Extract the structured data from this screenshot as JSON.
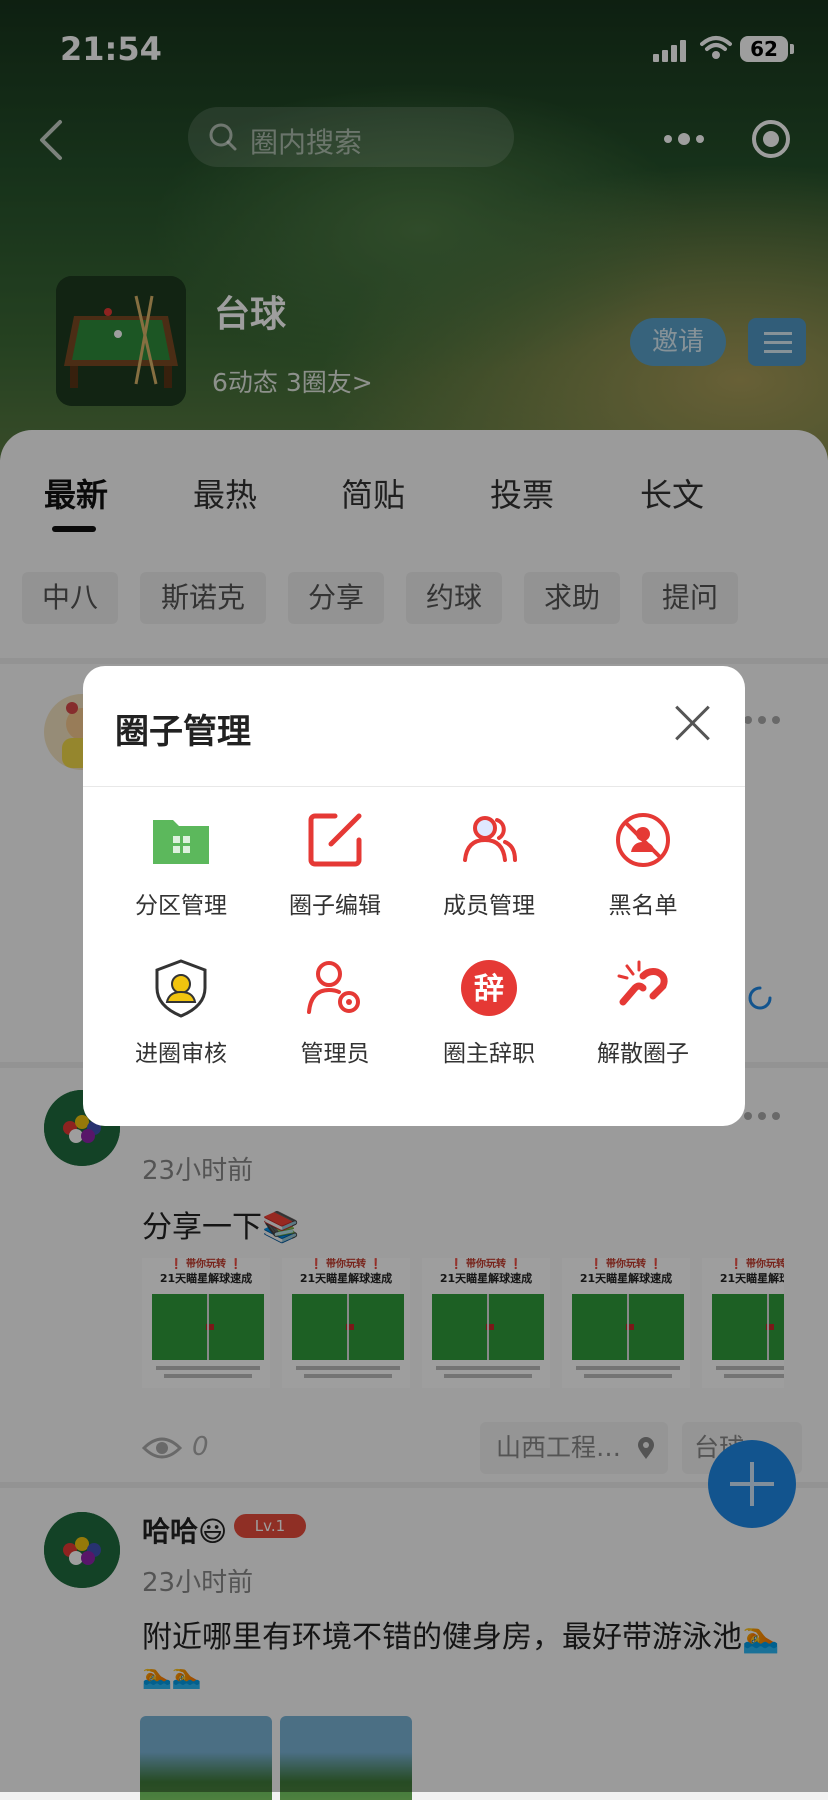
{
  "status_bar": {
    "time": "21:54",
    "battery": "62"
  },
  "search": {
    "placeholder": "圈内搜索"
  },
  "circle": {
    "name": "台球",
    "stats": "6动态 3圈友>",
    "invite_label": "邀请"
  },
  "tabs": [
    {
      "label": "最新",
      "active": true
    },
    {
      "label": "最热"
    },
    {
      "label": "简贴"
    },
    {
      "label": "投票"
    },
    {
      "label": "长文"
    }
  ],
  "chips": [
    "中八",
    "斯诺克",
    "分享",
    "约球",
    "求助",
    "提问"
  ],
  "posts": [
    {
      "time": "23小时前",
      "text": "分享一下📚",
      "thumb_title_1": "❗ 带你玩转 ❗",
      "thumb_title_2": "21天瞄星解球速成",
      "views": "0",
      "location": "山西工程…",
      "tag": "台球"
    },
    {
      "username": "哈哈😃",
      "level": "Lv.1",
      "time": "23小时前",
      "text_line1": "附近哪里有环境不错的健身房，最好带游泳池🏊",
      "text_line2": "🏊🏊"
    }
  ],
  "modal": {
    "title": "圈子管理",
    "items": [
      {
        "label": "分区管理",
        "icon": "folder-icon",
        "color": "#5cb85c"
      },
      {
        "label": "圈子编辑",
        "icon": "edit-icon",
        "color": "#e53935"
      },
      {
        "label": "成员管理",
        "icon": "members-icon",
        "color": "#e53935"
      },
      {
        "label": "黑名单",
        "icon": "blacklist-icon",
        "color": "#e53935"
      },
      {
        "label": "进圈审核",
        "icon": "shield-user-icon",
        "color": "#f1c40f"
      },
      {
        "label": "管理员",
        "icon": "admin-gear-icon",
        "color": "#e53935"
      },
      {
        "label": "圈主辞职",
        "icon": "resign-icon",
        "color": "#e53935",
        "glyph": "辞"
      },
      {
        "label": "解散圈子",
        "icon": "broken-link-icon",
        "color": "#e53935"
      }
    ]
  },
  "colors": {
    "accent_blue": "#1e88e5",
    "danger_red": "#e53935",
    "folder_green": "#5cb85c"
  }
}
